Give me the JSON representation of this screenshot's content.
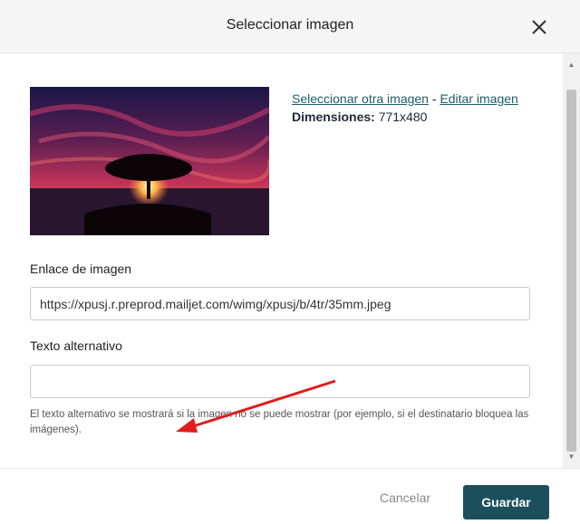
{
  "dialog": {
    "title": "Seleccionar imagen",
    "close_icon": "close-icon"
  },
  "image": {
    "select_other_label": "Seleccionar otra imagen",
    "separator": " - ",
    "edit_label": "Editar imagen",
    "dimensions_label": "Dimensiones:",
    "dimensions_value": "771x480",
    "preview_description_icon": "tree-sunset-image"
  },
  "link_field": {
    "label": "Enlace de imagen",
    "value": "https://xpusj.r.preprod.mailjet.com/wimg/xpusj/b/4tr/35mm.jpeg"
  },
  "alt_field": {
    "label": "Texto alternativo",
    "value": "",
    "help": "El texto alternativo se mostrará si la imagen no se puede mostrar (por ejemplo, si el destinatario bloquea las imágenes)."
  },
  "footer": {
    "cancel_label": "Cancelar",
    "save_label": "Guardar"
  },
  "colors": {
    "accent": "#1b4f5c",
    "link": "#1d5d6a",
    "annotation_arrow": "#e21b1b"
  }
}
